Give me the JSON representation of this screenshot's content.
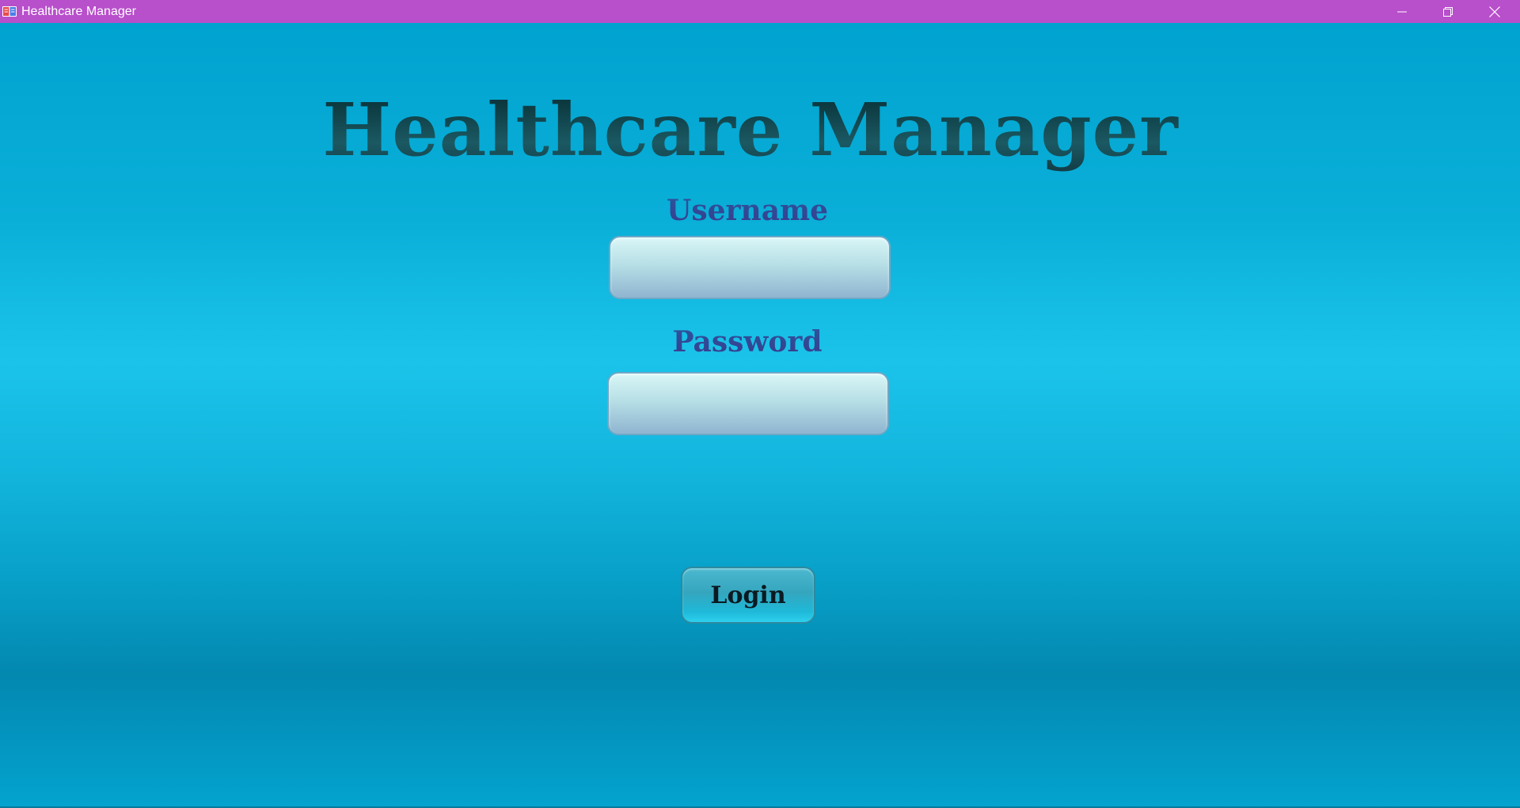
{
  "window": {
    "title": "Healthcare Manager",
    "app_icon": "open-book-icon",
    "controls": {
      "minimize_icon": "minimize-icon",
      "maximize_icon": "restore-icon",
      "close_icon": "close-icon"
    },
    "titlebar_color": "#b84fcb"
  },
  "main": {
    "heading": "Healthcare Manager",
    "username": {
      "label": "Username",
      "value": ""
    },
    "password": {
      "label": "Password",
      "value": ""
    },
    "login_label": "Login"
  },
  "colors": {
    "background_top": "#00a3cf",
    "background_mid": "#1bc3ea",
    "heading_text": "#123f48",
    "label_text": "#2d4c96",
    "button_bg": "#35a6be"
  }
}
